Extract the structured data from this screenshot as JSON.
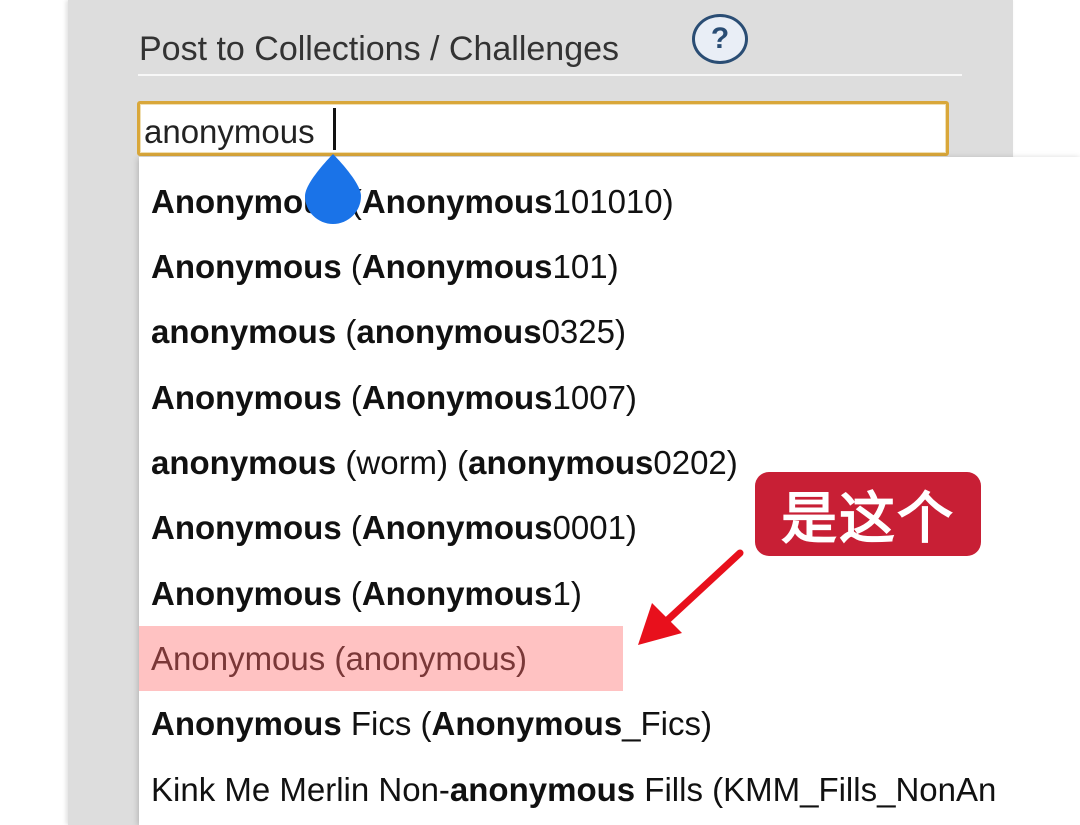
{
  "form": {
    "legend": "Post to Collections / Challenges",
    "help_label": "?"
  },
  "search": {
    "value": "anonymous"
  },
  "dropdown": {
    "items": [
      {
        "parts": [
          {
            "text": "Anonymous",
            "bold": true
          },
          {
            "text": " (",
            "bold": false
          },
          {
            "text": "Anonymous",
            "bold": true
          },
          {
            "text": "101010)",
            "bold": false
          }
        ]
      },
      {
        "parts": [
          {
            "text": "Anonymous",
            "bold": true
          },
          {
            "text": " (",
            "bold": false
          },
          {
            "text": "Anonymous",
            "bold": true
          },
          {
            "text": "101)",
            "bold": false
          }
        ]
      },
      {
        "parts": [
          {
            "text": "anonymous",
            "bold": true
          },
          {
            "text": " (",
            "bold": false
          },
          {
            "text": "anonymous",
            "bold": true
          },
          {
            "text": "0325)",
            "bold": false
          }
        ]
      },
      {
        "parts": [
          {
            "text": "Anonymous",
            "bold": true
          },
          {
            "text": " (",
            "bold": false
          },
          {
            "text": "Anonymous",
            "bold": true
          },
          {
            "text": "1007)",
            "bold": false
          }
        ]
      },
      {
        "parts": [
          {
            "text": "anonymous",
            "bold": true
          },
          {
            "text": " (worm) (",
            "bold": false
          },
          {
            "text": "anonymous",
            "bold": true
          },
          {
            "text": "0202)",
            "bold": false
          }
        ]
      },
      {
        "parts": [
          {
            "text": "Anonymous",
            "bold": true
          },
          {
            "text": " (",
            "bold": false
          },
          {
            "text": "Anonymous",
            "bold": true
          },
          {
            "text": "0001)",
            "bold": false
          }
        ]
      },
      {
        "parts": [
          {
            "text": "Anonymous",
            "bold": true
          },
          {
            "text": " (",
            "bold": false
          },
          {
            "text": "Anonymous",
            "bold": true
          },
          {
            "text": "1)",
            "bold": false
          }
        ]
      },
      {
        "parts": [
          {
            "text": "Anonymous",
            "bold": false
          },
          {
            "text": " (",
            "bold": false
          },
          {
            "text": "anonymous",
            "bold": false
          },
          {
            "text": ")",
            "bold": false
          }
        ],
        "highlighted": true
      },
      {
        "parts": [
          {
            "text": "Anonymous",
            "bold": true
          },
          {
            "text": " Fics (",
            "bold": false
          },
          {
            "text": "Anonymous",
            "bold": true
          },
          {
            "text": "_Fics)",
            "bold": false
          }
        ]
      },
      {
        "parts": [
          {
            "text": "Kink Me Merlin Non-",
            "bold": false
          },
          {
            "text": "anonymous",
            "bold": true
          },
          {
            "text": " Fills (KMM_Fills_NonAn",
            "bold": false
          }
        ]
      }
    ]
  },
  "annotation": {
    "label": "是这个",
    "color": "#c81f35"
  },
  "colors": {
    "highlight_bg": "#ffc2c2",
    "input_border": "#d9a73a",
    "handle": "#1a73e8"
  }
}
